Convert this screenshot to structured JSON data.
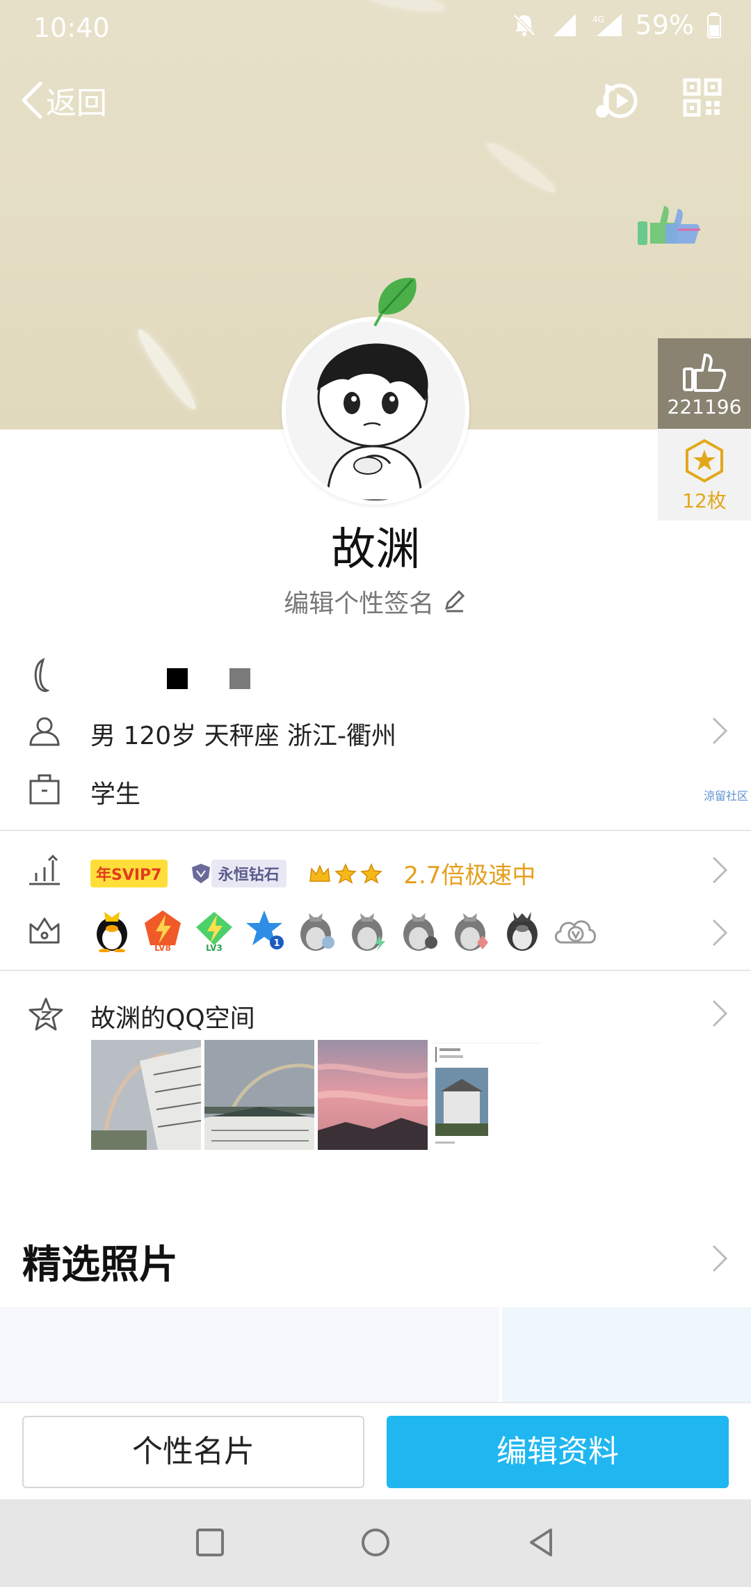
{
  "status_bar": {
    "time": "10:40",
    "battery": "59%",
    "network": "4G"
  },
  "nav": {
    "back_label": "返回"
  },
  "side": {
    "like_count": "221196",
    "medal_count": "12枚"
  },
  "profile": {
    "name": "故渊",
    "signature": "编辑个性签名"
  },
  "info": {
    "basic": "男  120岁  天秤座  浙江-衢州",
    "occupation": "学生",
    "watermark": "涼留社区"
  },
  "vip": {
    "svip": "年SVIP7",
    "diamond": "永恒钻石",
    "speed": "2.7倍极速中"
  },
  "service_icons": [
    {
      "name": "qq-penguin-icon"
    },
    {
      "name": "lightning-lv8-icon",
      "label": "LV8"
    },
    {
      "name": "lightning-lv3-icon",
      "label": "LV3"
    },
    {
      "name": "blue-star-icon",
      "label": "1"
    },
    {
      "name": "gray-penguin-icon-1"
    },
    {
      "name": "gray-penguin-icon-2"
    },
    {
      "name": "gray-penguin-icon-3"
    },
    {
      "name": "gray-penguin-icon-4"
    },
    {
      "name": "dark-penguin-icon"
    },
    {
      "name": "cloud-v-icon"
    }
  ],
  "qzone": {
    "title": "故渊的QQ空间"
  },
  "featured": {
    "title": "精选照片"
  },
  "buttons": {
    "card": "个性名片",
    "edit": "编辑资料"
  },
  "colors": {
    "accent": "#20b7f0",
    "vip_gold": "#e5a01d",
    "cover_bg": "#e4ddc3"
  }
}
